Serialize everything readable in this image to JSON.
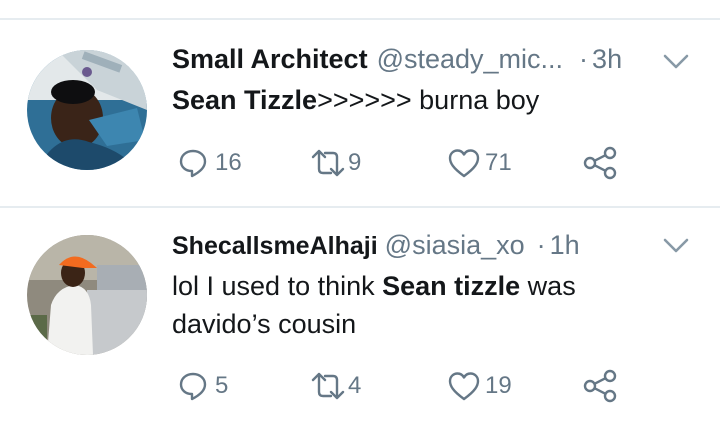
{
  "tweets": [
    {
      "display_name": "Small Architect",
      "handle": "@steady_mic...",
      "separator": "·",
      "time": "3h",
      "text_parts": [
        "Sean Tizzle",
        ">>>>>> burna boy"
      ],
      "replies": "16",
      "retweets": "9",
      "likes": "71"
    },
    {
      "display_name": "ShecallsmeAlhaji",
      "handle": "@siasia_xo",
      "separator": "·",
      "time": "1h",
      "text_parts": [
        "lol I used to think ",
        "Sean tizzle",
        " was",
        "davido’s cousin"
      ],
      "replies": "5",
      "retweets": "4",
      "likes": "19"
    }
  ],
  "icons": {
    "reply": "reply-icon",
    "retweet": "retweet-icon",
    "like": "heart-icon",
    "share": "share-icon",
    "menu": "chevron-down-icon"
  },
  "colors": {
    "text": "#14171a",
    "muted": "#657786",
    "divider": "#e6ecf0"
  }
}
